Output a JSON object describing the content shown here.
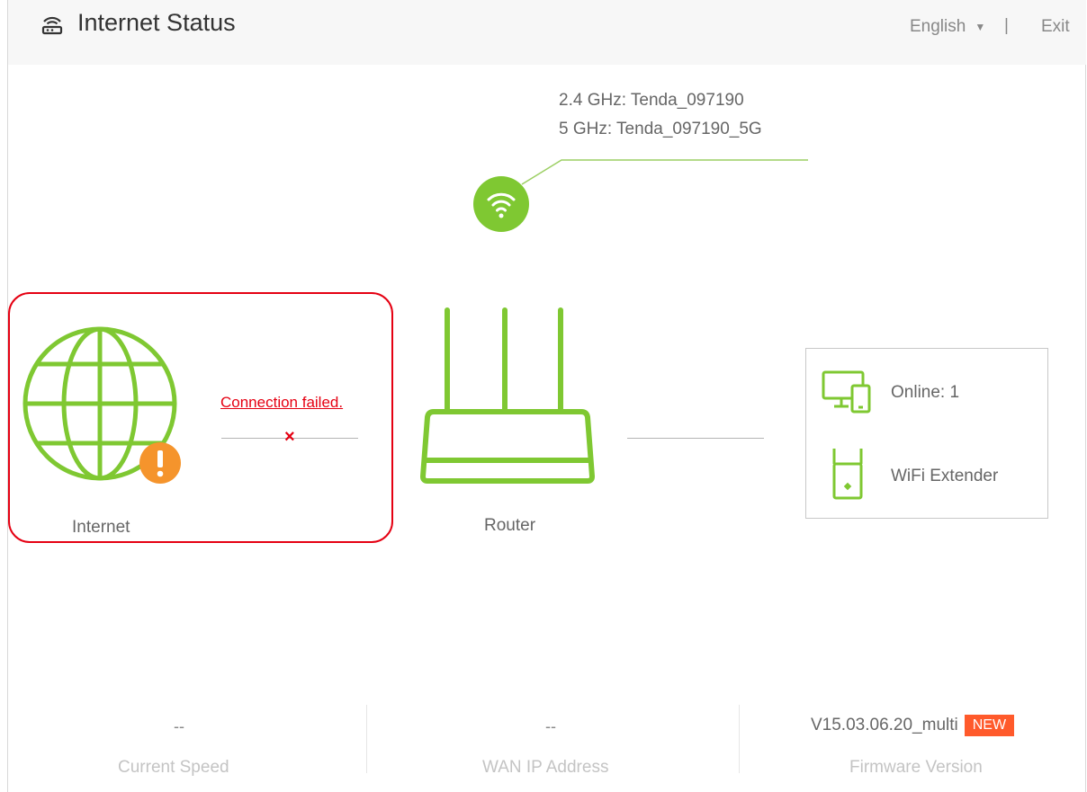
{
  "header": {
    "title": "Internet Status",
    "language": "English",
    "separator": "|",
    "exit_label": "Exit"
  },
  "wifi": {
    "ssid_24": "2.4 GHz: Tenda_097190",
    "ssid_5": "5 GHz: Tenda_097190_5G"
  },
  "internet": {
    "label": "Internet",
    "status_text": "Connection failed."
  },
  "router": {
    "label": "Router"
  },
  "devices": {
    "online_text": "Online:  1",
    "extender_label": "WiFi Extender"
  },
  "stats": {
    "speed_value": "--",
    "speed_label": "Current Speed",
    "wan_value": "--",
    "wan_label": "WAN IP Address",
    "firmware_value": "V15.03.06.20_multi",
    "firmware_badge": "NEW",
    "firmware_label": "Firmware Version"
  },
  "colors": {
    "accent_green": "#7fc832",
    "error_red": "#e50012",
    "warning_orange": "#f5942c",
    "new_badge": "#ff5a2b"
  },
  "icons": {
    "title": "router-status-icon",
    "wifi": "wifi-icon",
    "globe": "globe-icon",
    "warning": "warning-icon",
    "router": "router-icon",
    "devices": "devices-icon",
    "extender": "extender-icon"
  }
}
